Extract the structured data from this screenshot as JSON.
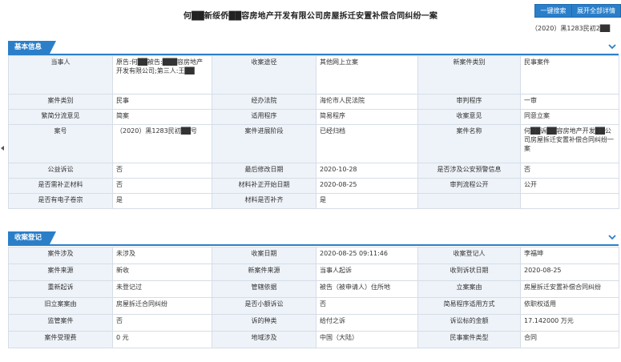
{
  "header": {
    "title": "何██新绥侨██容房地产开发有限公司房屋拆迁安置补偿合同纠纷一案",
    "case_no": "（2020）黑1283民初2██",
    "buttons": {
      "search": "一键搜索",
      "expand": "展开全部详情"
    }
  },
  "basic": {
    "section_title": "基本信息",
    "rows": [
      [
        "当事人",
        "原告:何██被告:███容房地产开发有限公司;第三人:王██",
        "收案途径",
        "其他网上立案",
        "新案件类别",
        "民事案件"
      ],
      [
        "案件类别",
        "民事",
        "经办法院",
        "海伦市人民法院",
        "审判程序",
        "一审"
      ],
      [
        "繁简分流意见",
        "简案",
        "适用程序",
        "简易程序",
        "收案意见",
        "同意立案"
      ],
      [
        "案号",
        "（2020）黑1283民初██号",
        "案件进展阶段",
        "已经归档",
        "案件名称",
        "何██诉██容房地产开发██公司房屋拆迁安置补偿合同纠纷一案"
      ],
      [
        "公益诉讼",
        "否",
        "最后修改日期",
        "2020-10-28",
        "是否涉及公安预警信息",
        "否"
      ],
      [
        "是否需补正材料",
        "否",
        "材料补正开始日期",
        "2020-08-25",
        "审判流程公开",
        "公开"
      ],
      [
        "是否有电子卷宗",
        "是",
        "材料是否补齐",
        "是",
        "",
        ""
      ]
    ]
  },
  "filing": {
    "section_title": "收案登记",
    "rows": [
      [
        "案件涉及",
        "未涉及",
        "收案日期",
        "2020-08-25 09:11:46",
        "收案登记人",
        "李福坤"
      ],
      [
        "案件来源",
        "新收",
        "新案件来源",
        "当事人起诉",
        "收到诉状日期",
        "2020-08-25"
      ],
      [
        "重新起诉",
        "未登记过",
        "管辖依据",
        "被告（被申请人）住所地",
        "立案案由",
        "房屋拆迁安置补偿合同纠纷"
      ],
      [
        "旧立案案由",
        "房屋拆迁合同纠纷",
        "是否小额诉讼",
        "否",
        "简易程序适用方式",
        "依职权适用"
      ],
      [
        "监管案件",
        "否",
        "诉的种类",
        "给付之诉",
        "诉讼标的金额",
        "17.142000 万元"
      ],
      [
        "案件受理费",
        "0 元",
        "地域涉及",
        "中国（大陆）",
        "民事案件类型",
        "合同"
      ]
    ]
  }
}
